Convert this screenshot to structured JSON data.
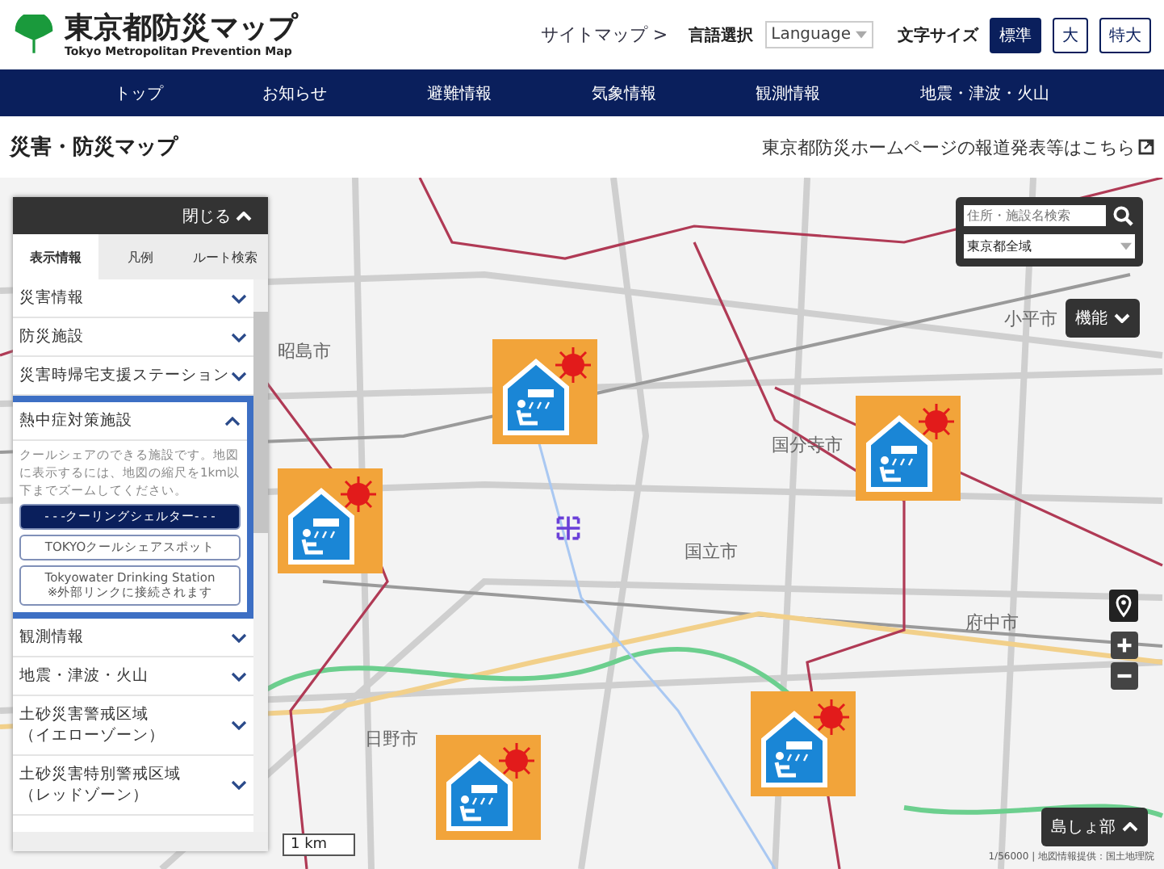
{
  "header": {
    "site_title": "東京都防災マップ",
    "site_subtitle": "Tokyo Metropolitan Prevention Map",
    "sitemap_link": "サイトマップ >",
    "language_label": "言語選択",
    "language_select": "Language",
    "text_size_label": "文字サイズ",
    "text_sizes": [
      {
        "label": "標準",
        "selected": true
      },
      {
        "label": "大",
        "selected": false
      },
      {
        "label": "特大",
        "selected": false
      }
    ]
  },
  "nav": [
    "トップ",
    "お知らせ",
    "避難情報",
    "気象情報",
    "観測情報",
    "地震・津波・火山"
  ],
  "page_title": "災害・防災マップ",
  "press_link": "東京都防災ホームページの報道発表等はこちら",
  "sidebar": {
    "close_button": "閉じる",
    "tabs": [
      {
        "label": "表示情報",
        "selected": true
      },
      {
        "label": "凡例",
        "selected": false
      },
      {
        "label": "ルート検索",
        "selected": false
      }
    ],
    "items": [
      {
        "label": "災害情報",
        "expanded": false
      },
      {
        "label": "防災施設",
        "expanded": false
      },
      {
        "label": "災害時帰宅支援ステーション",
        "expanded": false
      },
      {
        "label": "熱中症対策施設",
        "expanded": true,
        "description": "クールシェアのできる施設です。地図に表示するには、地図の縮尺を1km以下までズームしてください。",
        "options": [
          {
            "label": "- - -クーリングシェルター- - -",
            "selected": true
          },
          {
            "label": "TOKYOクールシェアスポット",
            "selected": false
          },
          {
            "label": "Tokyowater Drinking Station",
            "note": "※外部リンクに接続されます",
            "selected": false
          }
        ]
      },
      {
        "label": "観測情報",
        "expanded": false
      },
      {
        "label": "地震・津波・火山",
        "expanded": false
      },
      {
        "lines": [
          "土砂災害警戒区域",
          "（イエローゾーン）"
        ],
        "expanded": false
      },
      {
        "lines": [
          "土砂災害特別警戒区域",
          "（レッドゾーン）"
        ],
        "expanded": false
      }
    ]
  },
  "search": {
    "placeholder": "住所・施設名検索",
    "area_select": "東京都全域"
  },
  "function_button": "機能",
  "islands_button": "島しょ部",
  "map": {
    "place_labels": [
      "昭島市",
      "小平市",
      "国分寺市",
      "国立市",
      "府中市",
      "日野市"
    ],
    "scale": "1 km",
    "attribution": "1/56000 | 地図情報提供：国土地理院",
    "markers": [
      {
        "kind": "cooling_shelter"
      },
      {
        "kind": "cooling_shelter"
      },
      {
        "kind": "cooling_shelter"
      },
      {
        "kind": "cooling_shelter"
      },
      {
        "kind": "cooling_shelter"
      }
    ]
  }
}
